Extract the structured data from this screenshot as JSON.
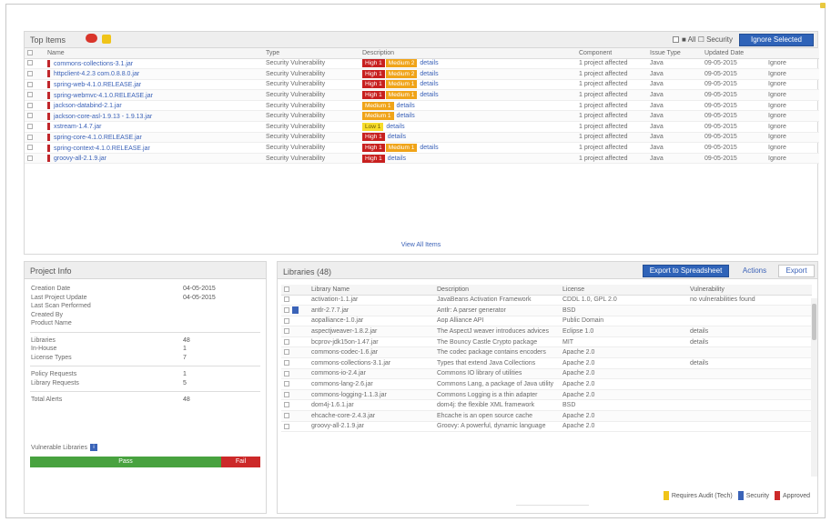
{
  "top": {
    "title": "Top Items",
    "toggle_label": "■ All ☐ Security",
    "ignore_button": "Ignore Selected",
    "columns": [
      "",
      "Name",
      "Type",
      "Description",
      "Component",
      "Issue Type",
      "Updated Date",
      ""
    ],
    "rows": [
      {
        "name": "commons-collections-3.1.jar",
        "type": "Security Vulnerability",
        "tags": [
          {
            "t": "High 1",
            "c": "red"
          },
          {
            "t": "Medium 2",
            "c": "orange"
          }
        ],
        "more": "details",
        "component": "1 project affected",
        "issue": "Java",
        "date": "09-05-2015",
        "action": "Ignore"
      },
      {
        "name": "httpclient-4.2.3 com.0.8.8.0.jar",
        "type": "Security Vulnerability",
        "tags": [
          {
            "t": "High 1",
            "c": "red"
          },
          {
            "t": "Medium 2",
            "c": "orange"
          }
        ],
        "more": "details",
        "component": "1 project affected",
        "issue": "Java",
        "date": "09-05-2015",
        "action": "Ignore"
      },
      {
        "name": "spring-web-4.1.0.RELEASE.jar",
        "type": "Security Vulnerability",
        "tags": [
          {
            "t": "High 1",
            "c": "red"
          },
          {
            "t": "Medium 1",
            "c": "orange"
          }
        ],
        "more": "details",
        "component": "1 project affected",
        "issue": "Java",
        "date": "09-05-2015",
        "action": "Ignore"
      },
      {
        "name": "spring-webmvc-4.1.0.RELEASE.jar",
        "type": "Security Vulnerability",
        "tags": [
          {
            "t": "High 1",
            "c": "red"
          },
          {
            "t": "Medium 1",
            "c": "orange"
          }
        ],
        "more": "details",
        "component": "1 project affected",
        "issue": "Java",
        "date": "09-05-2015",
        "action": "Ignore"
      },
      {
        "name": "jackson-databind-2.1.jar",
        "type": "Security Vulnerability",
        "tags": [
          {
            "t": "Medium 1",
            "c": "orange"
          }
        ],
        "more": "details",
        "component": "1 project affected",
        "issue": "Java",
        "date": "09-05-2015",
        "action": "Ignore"
      },
      {
        "name": "jackson-core-asl-1.9.13 - 1.9.13.jar",
        "type": "Security Vulnerability",
        "tags": [
          {
            "t": "Medium 1",
            "c": "orange"
          }
        ],
        "more": "details",
        "component": "1 project affected",
        "issue": "Java",
        "date": "09-05-2015",
        "action": "Ignore"
      },
      {
        "name": "xstream-1.4.7.jar",
        "type": "Security Vulnerability",
        "tags": [
          {
            "t": "Low 1",
            "c": "yellow"
          }
        ],
        "more": "details",
        "component": "1 project affected",
        "issue": "Java",
        "date": "09-05-2015",
        "action": "Ignore"
      },
      {
        "name": "spring-core-4.1.0.RELEASE.jar",
        "type": "Security Vulnerability",
        "tags": [
          {
            "t": "High 1",
            "c": "red"
          }
        ],
        "more": "details",
        "component": "1 project affected",
        "issue": "Java",
        "date": "09-05-2015",
        "action": "Ignore"
      },
      {
        "name": "spring-context-4.1.0.RELEASE.jar",
        "type": "Security Vulnerability",
        "tags": [
          {
            "t": "High 1",
            "c": "red"
          },
          {
            "t": "Medium 1",
            "c": "orange"
          }
        ],
        "more": "details",
        "component": "1 project affected",
        "issue": "Java",
        "date": "09-05-2015",
        "action": "Ignore"
      },
      {
        "name": "groovy-all-2.1.9.jar",
        "type": "Security Vulnerability",
        "tags": [
          {
            "t": "High 1",
            "c": "red"
          }
        ],
        "more": "details",
        "component": "1 project affected",
        "issue": "Java",
        "date": "09-05-2015",
        "action": "Ignore"
      }
    ],
    "footer_link": "View All Items"
  },
  "left": {
    "title": "Project Info",
    "group1": [
      {
        "k": "Creation Date",
        "v": "04-05-2015"
      },
      {
        "k": "Last Project Update",
        "v": "04-05-2015"
      },
      {
        "k": "Last Scan Performed",
        "v": ""
      },
      {
        "k": "Created By",
        "v": ""
      },
      {
        "k": "Product Name",
        "v": ""
      }
    ],
    "group2": [
      {
        "k": "Libraries",
        "v": "48"
      },
      {
        "k": "In-House",
        "v": "1"
      },
      {
        "k": "License Types",
        "v": "7"
      }
    ],
    "group3": [
      {
        "k": "Policy Requests",
        "v": "1"
      },
      {
        "k": "Library Requests",
        "v": "5"
      }
    ],
    "group4": [
      {
        "k": "Total Alerts",
        "v": "48"
      }
    ],
    "unpatched_label": "Vulnerable Libraries",
    "bar": {
      "green_label": "Pass",
      "green_fraction": 0.83,
      "red_label": "Fail"
    }
  },
  "right": {
    "title": "Libraries (48)",
    "primary_button": "Export to Spreadsheet",
    "button2": "Actions",
    "button3": "Export",
    "columns": [
      "",
      "Library Name",
      "Description",
      "License",
      "Vulnerability"
    ],
    "rows": [
      {
        "name": "activation-1.1.jar",
        "desc": "JavaBeans Activation Framework",
        "license": "CDDL 1.0, GPL 2.0",
        "vuln": "no vulnerabilities found",
        "icon": false
      },
      {
        "name": "antlr-2.7.7.jar",
        "desc": "Antlr: A parser generator",
        "license": "BSD",
        "vuln": "",
        "icon": true
      },
      {
        "name": "aopalliance-1.0.jar",
        "desc": "Aop Alliance API",
        "license": "Public Domain",
        "vuln": "",
        "icon": false
      },
      {
        "name": "aspectjweaver-1.8.2.jar",
        "desc": "The AspectJ weaver introduces advices",
        "license": "Eclipse 1.0",
        "vuln": "details",
        "icon": false
      },
      {
        "name": "bcprov-jdk15on-1.47.jar",
        "desc": "The Bouncy Castle Crypto package",
        "license": "MIT",
        "vuln": "details",
        "icon": false
      },
      {
        "name": "commons-codec-1.6.jar",
        "desc": "The codec package contains encoders",
        "license": "Apache 2.0",
        "vuln": "",
        "icon": false
      },
      {
        "name": "commons-collections-3.1.jar",
        "desc": "Types that extend Java Collections",
        "license": "Apache 2.0",
        "vuln": "details",
        "icon": false
      },
      {
        "name": "commons-io-2.4.jar",
        "desc": "Commons IO library of utilities",
        "license": "Apache 2.0",
        "vuln": "",
        "icon": false
      },
      {
        "name": "commons-lang-2.6.jar",
        "desc": "Commons Lang, a package of Java utility",
        "license": "Apache 2.0",
        "vuln": "",
        "icon": false
      },
      {
        "name": "commons-logging-1.1.3.jar",
        "desc": "Commons Logging is a thin adapter",
        "license": "Apache 2.0",
        "vuln": "",
        "icon": false
      },
      {
        "name": "dom4j-1.6.1.jar",
        "desc": "dom4j: the flexible XML framework",
        "license": "BSD",
        "vuln": "",
        "icon": false
      },
      {
        "name": "ehcache-core-2.4.3.jar",
        "desc": "Ehcache is an open source cache",
        "license": "Apache 2.0",
        "vuln": "",
        "icon": false
      },
      {
        "name": "groovy-all-2.1.9.jar",
        "desc": "Groovy: A powerful, dynamic language",
        "license": "Apache 2.0",
        "vuln": "",
        "icon": false
      }
    ],
    "legend": [
      {
        "label": "Requires Audit (Tech)",
        "color": "#f0c419"
      },
      {
        "label": "Security",
        "color": "#3a63b8"
      },
      {
        "label": "Approved",
        "color": "#cc2929"
      }
    ]
  }
}
